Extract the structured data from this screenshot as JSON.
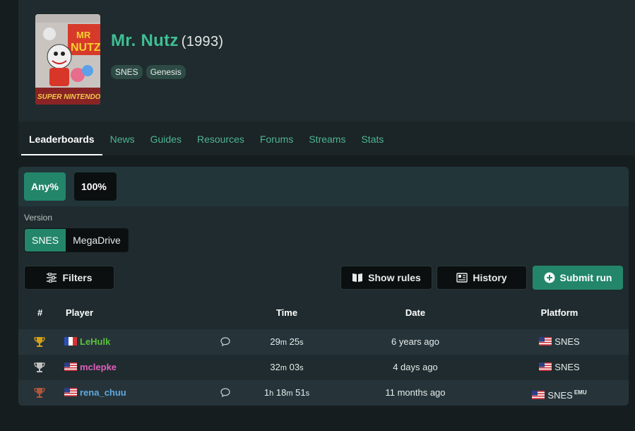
{
  "game": {
    "title": "Mr. Nutz",
    "year": "(1993)",
    "platforms": [
      "SNES",
      "Genesis"
    ]
  },
  "nav": {
    "tabs": [
      "Leaderboards",
      "News",
      "Guides",
      "Resources",
      "Forums",
      "Streams",
      "Stats"
    ],
    "active": "Leaderboards"
  },
  "categories": {
    "items": [
      "Any%",
      "100%"
    ],
    "selected": "Any%"
  },
  "version": {
    "label": "Version",
    "options": [
      "SNES",
      "MegaDrive"
    ],
    "selected": "SNES"
  },
  "toolbar": {
    "filters_label": "Filters",
    "show_rules_label": "Show rules",
    "history_label": "History",
    "submit_label": "Submit run"
  },
  "table": {
    "headers": {
      "rank": "#",
      "player": "Player",
      "time": "Time",
      "date": "Date",
      "platform": "Platform"
    },
    "rows": [
      {
        "trophy": "gold",
        "country": "fr",
        "player": "LeHulk",
        "player_color": "#5cc13a",
        "has_comment": true,
        "time_h": "",
        "time_m": "29",
        "time_s": "25",
        "date": "6 years ago",
        "platform": "SNES",
        "emu": ""
      },
      {
        "trophy": "silver",
        "country": "us",
        "player": "mclepke",
        "player_color": "#e05fbd",
        "has_comment": false,
        "time_h": "",
        "time_m": "32",
        "time_s": "03",
        "date": "4 days ago",
        "platform": "SNES",
        "emu": ""
      },
      {
        "trophy": "bronze",
        "country": "us",
        "player": "rena_chuu",
        "player_color": "#5fa8e0",
        "has_comment": true,
        "time_h": "1",
        "time_m": "18",
        "time_s": "51",
        "date": "11 months ago",
        "platform": "SNES",
        "emu": "EMU"
      }
    ]
  },
  "colors": {
    "accent": "#23866a",
    "title_green": "#3fbf94",
    "gold": "#d4a017",
    "silver": "#c0c0c0",
    "bronze": "#b0563a"
  }
}
